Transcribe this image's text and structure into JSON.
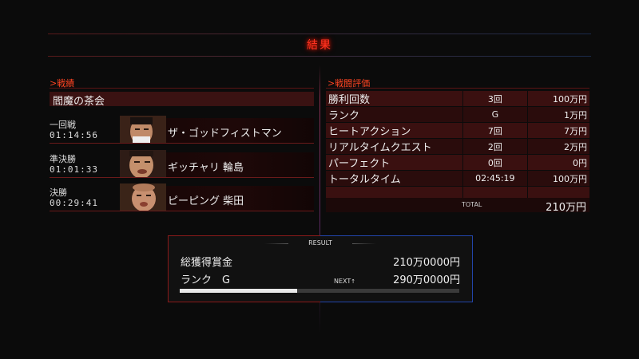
{
  "header": {
    "title": "結果"
  },
  "record": {
    "section_label": ">戦績",
    "tournament": "閻魔の茶会",
    "battles": [
      {
        "round": "一回戦",
        "time": "01:14:56",
        "opponent": "ザ・ゴッドフィストマン"
      },
      {
        "round": "準決勝",
        "time": "01:01:33",
        "opponent": "ギッチャリ 輪島"
      },
      {
        "round": "決勝",
        "time": "00:29:41",
        "opponent": "ピーピング 柴田"
      }
    ]
  },
  "evaluation": {
    "section_label": ">戦闘評価",
    "rows": [
      {
        "label": "勝利回数",
        "value": "3回",
        "reward": "100万円"
      },
      {
        "label": "ランク",
        "value": "G",
        "reward": "1万円"
      },
      {
        "label": "ヒートアクション",
        "value": "7回",
        "reward": "7万円"
      },
      {
        "label": "リアルタイムクエスト",
        "value": "2回",
        "reward": "2万円"
      },
      {
        "label": "パーフェクト",
        "value": "0回",
        "reward": "0円"
      },
      {
        "label": "トータルタイム",
        "value": "02:45:19",
        "reward": "100万円"
      }
    ],
    "total_label": "TOTAL",
    "total_value": "210万円"
  },
  "result": {
    "heading": "RESULT",
    "total_prize_label": "総獲得賞金",
    "total_prize_value": "210万0000円",
    "rank_label": "ランク　G",
    "next_label": "NEXT",
    "next_value": "290万0000円",
    "progress": 0.42
  }
}
